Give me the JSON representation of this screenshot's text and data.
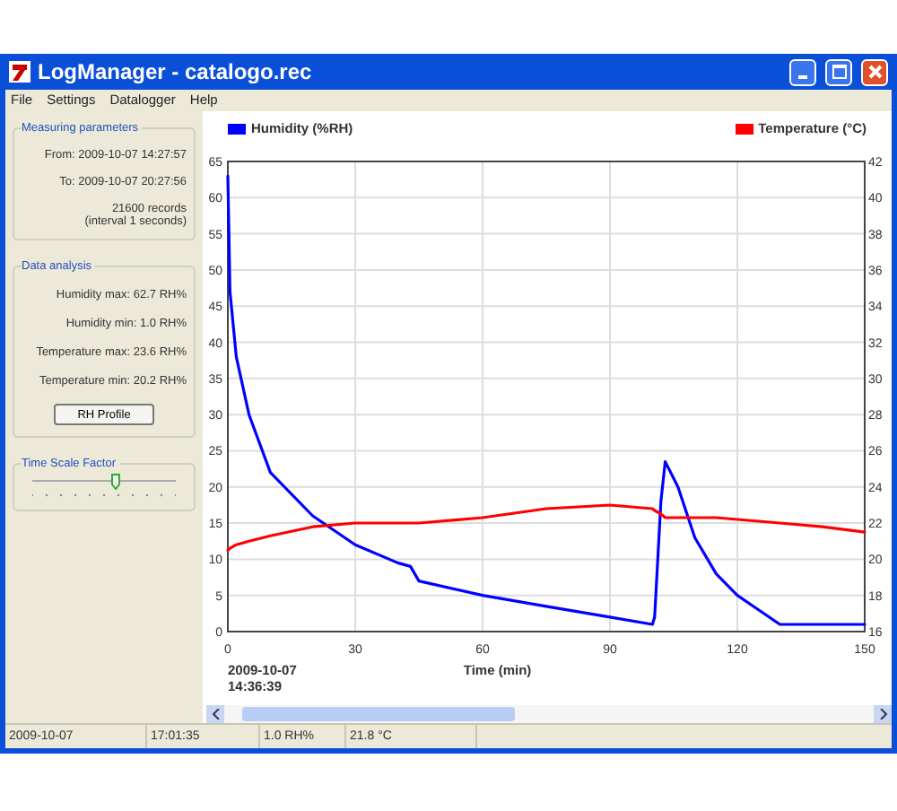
{
  "window": {
    "title": "LogManager - catalogo.rec"
  },
  "menu": [
    "File",
    "Settings",
    "Datalogger",
    "Help"
  ],
  "measuring": {
    "title": "Measuring parameters",
    "from": "From: 2009-10-07 14:27:57",
    "to": "To: 2009-10-07 20:27:56",
    "records": "21600 records",
    "interval": "(interval 1 seconds)"
  },
  "analysis": {
    "title": "Data analysis",
    "rows": [
      "Humidity max: 62.7 RH%",
      "Humidity min: 1.0 RH%",
      "Temperature max: 23.6 RH%",
      "Temperature min: 20.2 RH%"
    ],
    "button": "RH Profile"
  },
  "time_scale": {
    "title": "Time Scale Factor",
    "level": 0.58
  },
  "chart": {
    "start_date": "2009-10-07",
    "start_time": "14:36:39",
    "chart_data": {
      "type": "line",
      "grid": true,
      "xlabel": "Time (min)",
      "xlim": [
        0,
        150
      ],
      "ylim": [
        0,
        65
      ],
      "y2lim": [
        16,
        42
      ],
      "xticks": [
        0,
        30,
        60,
        90,
        120,
        150
      ],
      "yticks": [
        0,
        5,
        10,
        15,
        20,
        25,
        30,
        35,
        40,
        45,
        50,
        55,
        60,
        65
      ],
      "y2ticks": [
        16,
        18,
        20,
        22,
        24,
        26,
        28,
        30,
        32,
        34,
        36,
        38,
        40,
        42
      ],
      "x": [
        0,
        0.5,
        2,
        5,
        10,
        20,
        30,
        40,
        43,
        45,
        60,
        75,
        90,
        100,
        100.5,
        102,
        103,
        106,
        110,
        115,
        120,
        125,
        130,
        140,
        150
      ],
      "series": [
        {
          "name": "Humidity (%RH)",
          "color": "#0000ff",
          "values": [
            63,
            47,
            38,
            30,
            22,
            16,
            12,
            9.5,
            9,
            7,
            5,
            3.5,
            2,
            1,
            2,
            18,
            23.5,
            20,
            13,
            8,
            5,
            3,
            1,
            1,
            1
          ]
        },
        {
          "name": "Temperature (°C)",
          "color": "#ff0000",
          "axis": "y2",
          "values": [
            20.5,
            20.6,
            20.8,
            21.0,
            21.3,
            21.8,
            22.0,
            22.0,
            22.0,
            22.0,
            22.3,
            22.8,
            23.0,
            22.8,
            22.7,
            22.5,
            22.3,
            22.3,
            22.3,
            22.3,
            22.2,
            22.1,
            22.0,
            21.8,
            21.5
          ]
        }
      ]
    }
  },
  "status_bar": [
    "2009-10-07",
    "17:01:35",
    "1.0 RH%",
    "21.8 °C"
  ]
}
